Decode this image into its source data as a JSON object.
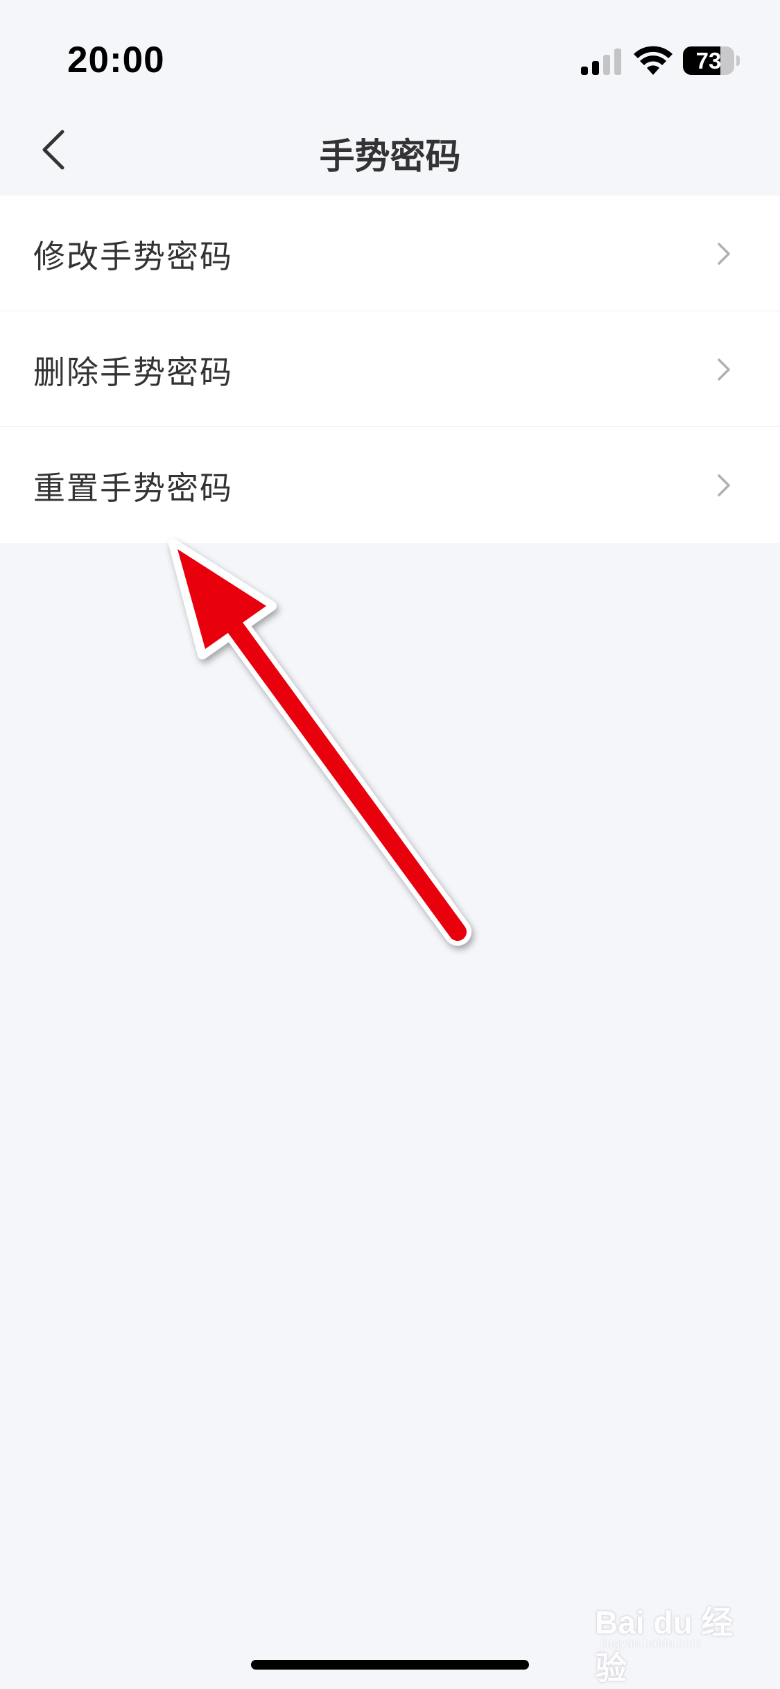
{
  "status_bar": {
    "time": "20:00",
    "battery_level": "73",
    "icons": [
      "signal-icon",
      "wifi-icon",
      "battery-icon"
    ]
  },
  "nav": {
    "title": "手势密码",
    "back_icon": "back-chevron-icon"
  },
  "menu": {
    "items": [
      {
        "label": "修改手势密码",
        "icon": "chevron-right-icon"
      },
      {
        "label": "删除手势密码",
        "icon": "chevron-right-icon"
      },
      {
        "label": "重置手势密码",
        "icon": "chevron-right-icon"
      }
    ]
  },
  "annotation": {
    "type": "arrow",
    "color": "#e8000b",
    "points_to": "重置手势密码"
  },
  "watermark": {
    "text": "Bai du 经验",
    "sub": "jingyan.baidu.com"
  },
  "colors": {
    "background": "#f5f6fa",
    "card": "#ffffff",
    "text": "#333333",
    "chevron": "#b0b0b5"
  }
}
